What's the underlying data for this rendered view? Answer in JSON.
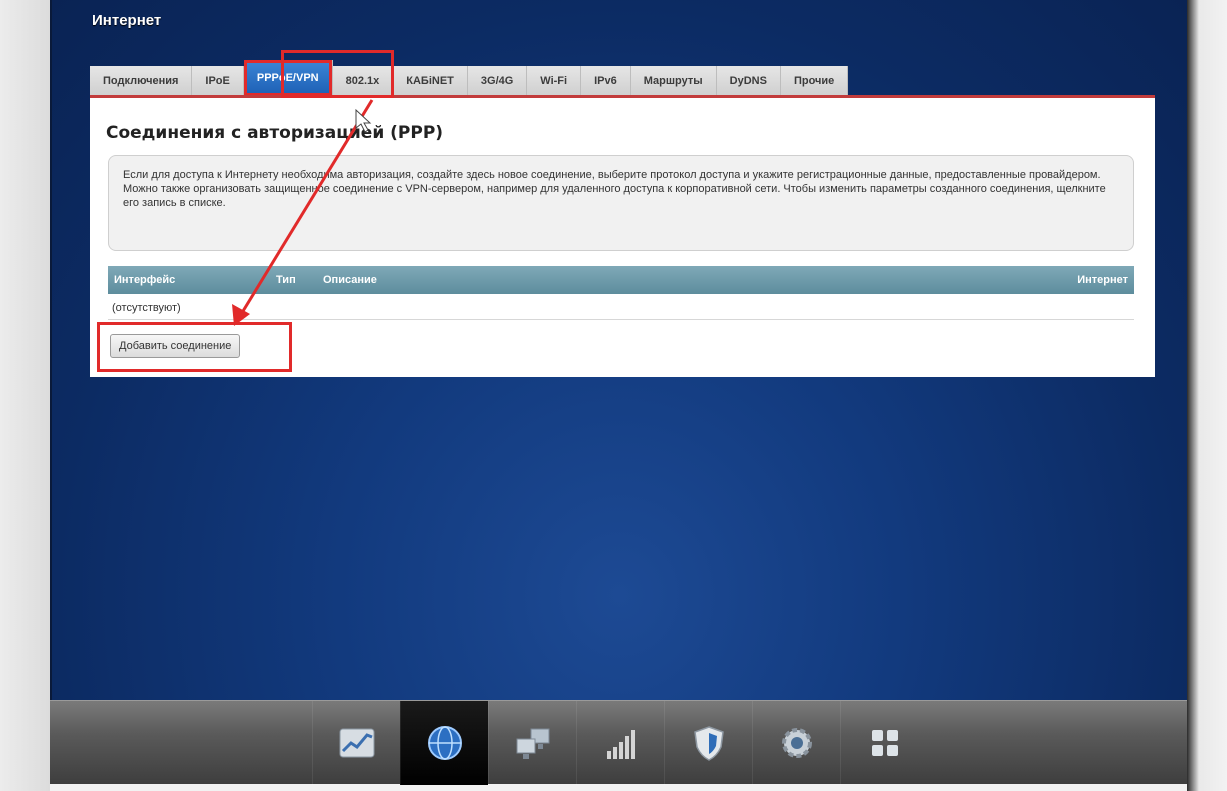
{
  "page": {
    "title": "Интернет"
  },
  "tabs": [
    {
      "label": "Подключения",
      "active": false
    },
    {
      "label": "IPoE",
      "active": false
    },
    {
      "label": "PPPoE/VPN",
      "active": true
    },
    {
      "label": "802.1x",
      "active": false
    },
    {
      "label": "КАБiNET",
      "active": false
    },
    {
      "label": "3G/4G",
      "active": false
    },
    {
      "label": "Wi-Fi",
      "active": false
    },
    {
      "label": "IPv6",
      "active": false
    },
    {
      "label": "Маршруты",
      "active": false
    },
    {
      "label": "DyDNS",
      "active": false
    },
    {
      "label": "Прочие",
      "active": false
    }
  ],
  "section": {
    "title": "Соединения с авторизацией (PPP)",
    "info": "Если для доступа к Интернету необходима авторизация, создайте здесь новое соединение, выберите протокол доступа и укажите регистрационные данные, предоставленные провайдером. Можно также организовать защищенное соединение с VPN-сервером, например для удаленного доступа к корпоративной сети. Чтобы изменить параметры созданного соединения, щелкните его запись в списке."
  },
  "table": {
    "columns": {
      "interface": "Интерфейс",
      "type": "Тип",
      "description": "Описание",
      "internet": "Интернет"
    },
    "empty": "(отсутствуют)"
  },
  "buttons": {
    "add_connection": "Добавить соединение"
  },
  "dock": [
    {
      "icon": "chart-icon",
      "active": false
    },
    {
      "icon": "globe-icon",
      "active": true
    },
    {
      "icon": "network-icon",
      "active": false
    },
    {
      "icon": "signal-bars-icon",
      "active": false
    },
    {
      "icon": "shield-icon",
      "active": false
    },
    {
      "icon": "gear-icon",
      "active": false
    },
    {
      "icon": "apps-grid-icon",
      "active": false
    }
  ],
  "colors": {
    "accent": "#1c5fb4",
    "highlight": "#e12a2a",
    "table_header": "#6f9aa9"
  }
}
